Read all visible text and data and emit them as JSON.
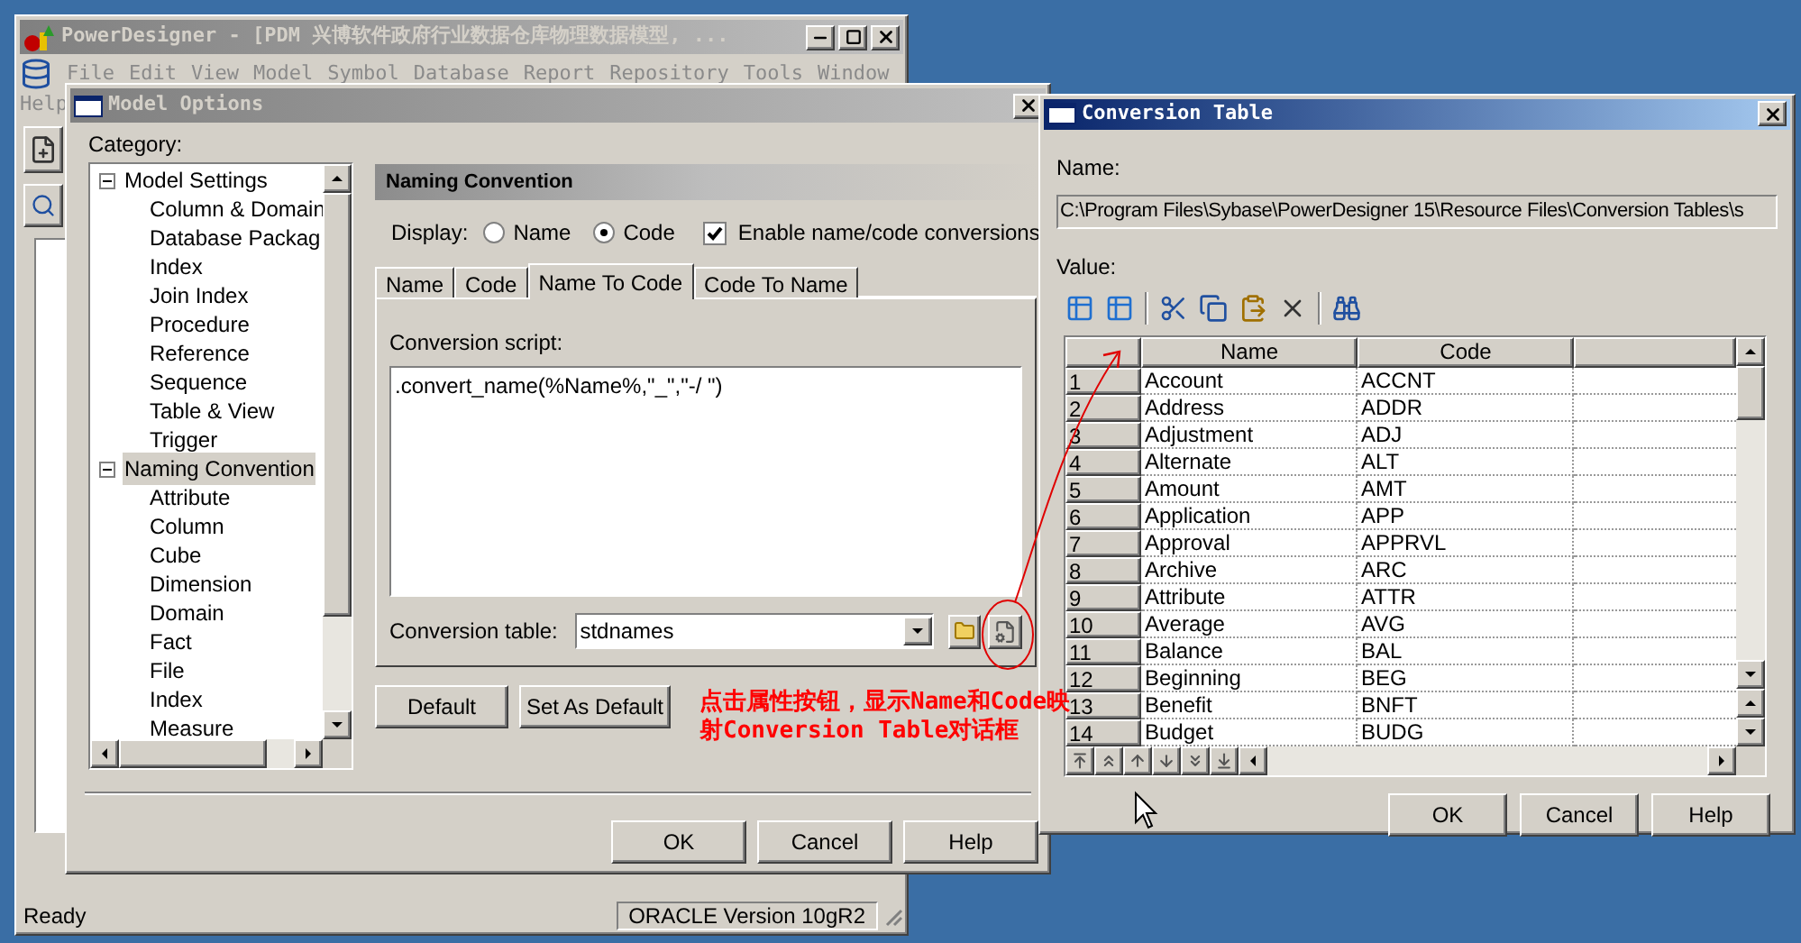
{
  "main_window": {
    "title": "PowerDesigner - [PDM 兴博软件政府行业数据仓库物理数据模型, ...",
    "menu": [
      "File",
      "Edit",
      "View",
      "Model",
      "Symbol",
      "Database",
      "Report",
      "Repository",
      "Tools",
      "Window",
      "Help"
    ],
    "status": "Ready",
    "status_panel": "ORACLE Version 10gR2"
  },
  "model_options": {
    "title": "Model Options",
    "category_label": "Category:",
    "tree": [
      {
        "label": "Model Settings",
        "expanded": true,
        "selected": false,
        "children": [
          {
            "label": "Column & Domain",
            "selected": false
          },
          {
            "label": "Database Packag",
            "selected": false
          },
          {
            "label": "Index",
            "selected": false
          },
          {
            "label": "Join Index",
            "selected": false
          },
          {
            "label": "Procedure",
            "selected": false
          },
          {
            "label": "Reference",
            "selected": false
          },
          {
            "label": "Sequence",
            "selected": false
          },
          {
            "label": "Table & View",
            "selected": false
          },
          {
            "label": "Trigger",
            "selected": false
          }
        ]
      },
      {
        "label": "Naming Convention",
        "expanded": true,
        "selected": true,
        "children": [
          {
            "label": "Attribute",
            "selected": false
          },
          {
            "label": "Column",
            "selected": false
          },
          {
            "label": "Cube",
            "selected": false
          },
          {
            "label": "Dimension",
            "selected": false
          },
          {
            "label": "Domain",
            "selected": false
          },
          {
            "label": "Fact",
            "selected": false
          },
          {
            "label": "File",
            "selected": false
          },
          {
            "label": "Index",
            "selected": false
          },
          {
            "label": "Measure",
            "selected": false
          }
        ]
      }
    ],
    "section_title": "Naming Convention",
    "display_label": "Display:",
    "display_options": [
      {
        "label": "Name",
        "selected": false
      },
      {
        "label": "Code",
        "selected": true
      }
    ],
    "enable_conversions": {
      "label": "Enable name/code conversions",
      "checked": true
    },
    "tabs": [
      {
        "label": "Name",
        "selected": false
      },
      {
        "label": "Code",
        "selected": false
      },
      {
        "label": "Name To Code",
        "selected": true
      },
      {
        "label": "Code To Name",
        "selected": false
      }
    ],
    "script_label": "Conversion script:",
    "script": ".convert_name(%Name%,\"_\",\"-/ \")",
    "table_label": "Conversion table:",
    "table_value": "stdnames",
    "panel_buttons": [
      "Default",
      "Set As Default"
    ],
    "buttons": [
      "OK",
      "Cancel",
      "Help"
    ]
  },
  "annotation": {
    "lines": [
      "点击属性按钮，显示Name和Code映",
      "射Conversion Table对话框"
    ]
  },
  "conversion_table": {
    "title": "Conversion Table",
    "name_label": "Name:",
    "name_value": "C:\\Program Files\\Sybase\\PowerDesigner 15\\Resource Files\\Conversion Tables\\s",
    "value_label": "Value:",
    "columns": [
      "Name",
      "Code"
    ],
    "rows": [
      {
        "number": "1",
        "name": "Account",
        "code": "ACCNT"
      },
      {
        "number": "2",
        "name": "Address",
        "code": "ADDR"
      },
      {
        "number": "3",
        "name": "Adjustment",
        "code": "ADJ"
      },
      {
        "number": "4",
        "name": "Alternate",
        "code": "ALT"
      },
      {
        "number": "5",
        "name": "Amount",
        "code": "AMT"
      },
      {
        "number": "6",
        "name": "Application",
        "code": "APP"
      },
      {
        "number": "7",
        "name": "Approval",
        "code": "APPRVL"
      },
      {
        "number": "8",
        "name": "Archive",
        "code": "ARC"
      },
      {
        "number": "9",
        "name": "Attribute",
        "code": "ATTR"
      },
      {
        "number": "10",
        "name": "Average",
        "code": "AVG"
      },
      {
        "number": "11",
        "name": "Balance",
        "code": "BAL"
      },
      {
        "number": "12",
        "name": "Beginning",
        "code": "BEG"
      },
      {
        "number": "13",
        "name": "Benefit",
        "code": "BNFT"
      },
      {
        "number": "14",
        "name": "Budget",
        "code": "BUDG"
      }
    ],
    "buttons": [
      "OK",
      "Cancel",
      "Help"
    ]
  }
}
